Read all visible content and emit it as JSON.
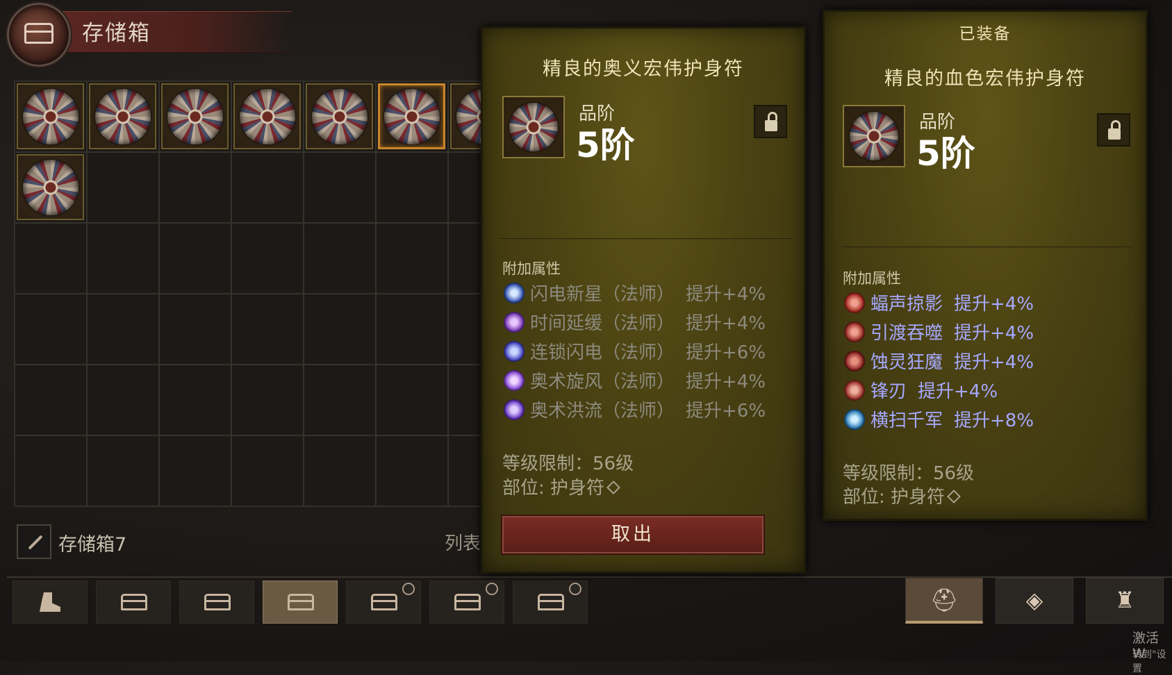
{
  "stash": {
    "title": "存储箱",
    "name": "存储箱7",
    "list_label": "列表"
  },
  "grid_items": [
    {
      "name": "amulet",
      "selected": false
    },
    {
      "name": "amulet",
      "selected": false
    },
    {
      "name": "amulet",
      "selected": false
    },
    {
      "name": "amulet",
      "selected": false
    },
    {
      "name": "amulet",
      "selected": false
    },
    {
      "name": "amulet",
      "selected": true
    },
    {
      "name": "amulet",
      "selected": false
    },
    {
      "name": "amulet",
      "selected": false
    }
  ],
  "tooltip_selected": {
    "title": "精良的奥义宏伟护身符",
    "grade_label": "品阶",
    "grade_value": "5阶",
    "affix_header": "附加属性",
    "affixes": [
      {
        "icon": "lightning-nova-icon",
        "name": "闪电新星（法师）",
        "bonus": "提升+4%"
      },
      {
        "icon": "time-slow-icon",
        "name": "时间延缓（法师）",
        "bonus": "提升+4%"
      },
      {
        "icon": "chain-lightning-icon",
        "name": "连锁闪电（法师）",
        "bonus": "提升+6%"
      },
      {
        "icon": "arcane-whirlwind-icon",
        "name": "奥术旋风（法师）",
        "bonus": "提升+4%"
      },
      {
        "icon": "arcane-torrent-icon",
        "name": "奥术洪流（法师）",
        "bonus": "提升+6%"
      }
    ],
    "level_req": "等级限制：56级",
    "slot": "部位: 护身符",
    "action_label": "取出"
  },
  "tooltip_equipped": {
    "header": "已装备",
    "title": "精良的血色宏伟护身符",
    "grade_label": "品阶",
    "grade_value": "5阶",
    "affix_header": "附加属性",
    "affixes": [
      {
        "icon": "bat-shadow-icon",
        "name": "蝠声掠影",
        "bonus": "提升+4%"
      },
      {
        "icon": "soul-ferry-icon",
        "name": "引渡吞噬",
        "bonus": "提升+4%"
      },
      {
        "icon": "frenzy-demon-icon",
        "name": "蚀灵狂魔",
        "bonus": "提升+4%"
      },
      {
        "icon": "blade-icon",
        "name": "锋刃",
        "bonus": "提升+4%"
      },
      {
        "icon": "sweep-icon",
        "name": "横扫千军",
        "bonus": "提升+8%"
      }
    ],
    "level_req": "等级限制：56级",
    "slot": "部位: 护身符"
  },
  "bottom_tabs": [
    {
      "icon": "boot-icon",
      "active": false,
      "locked": false
    },
    {
      "icon": "chest-icon",
      "active": false,
      "locked": false
    },
    {
      "icon": "chest-icon",
      "active": false,
      "locked": false
    },
    {
      "icon": "chest-icon",
      "active": true,
      "locked": false
    },
    {
      "icon": "chest-icon",
      "active": false,
      "locked": true
    },
    {
      "icon": "chest-icon",
      "active": false,
      "locked": true
    },
    {
      "icon": "chest-icon",
      "active": false,
      "locked": true
    }
  ],
  "right_tabs": [
    {
      "icon": "helmet-icon",
      "glyph": "⛑",
      "active": true
    },
    {
      "icon": "gem-pile-icon",
      "glyph": "◈",
      "active": false
    },
    {
      "icon": "bag-icon",
      "glyph": "♜",
      "active": false
    }
  ],
  "watermark": {
    "line1": "激活 W",
    "line2": "转到\"设置"
  },
  "colors": {
    "card_bg": "#4a4212",
    "affix_dim": "#8c8a7e",
    "affix_bright": "#a6a8ff",
    "button_red": "#6a241c",
    "selected_border": "#c9862a"
  }
}
